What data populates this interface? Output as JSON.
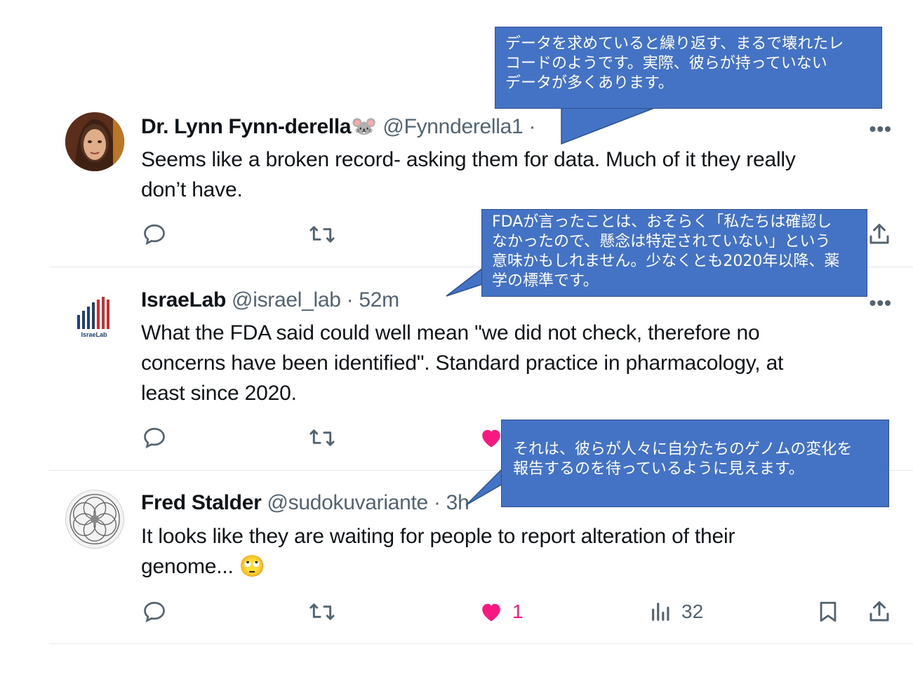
{
  "tweets": [
    {
      "name": "Dr. Lynn Fynn-derella",
      "name_emoji": "🐭",
      "handle": "@Fynnderella1 ·",
      "text_line1": "Seems like a broken record- asking them for data. Much of it they really",
      "text_line2": "don’t have.",
      "more": "•••"
    },
    {
      "name": "IsraeLab",
      "handle": "@israel_lab · 52m",
      "text_line1": "What the FDA said could well mean \"we did not check, therefore no",
      "text_line2": "concerns have been identified\". Standard practice in pharmacology, at",
      "text_line3": "least since 2020.",
      "logo_text": "IsraeLab",
      "more": "•••"
    },
    {
      "name": "Fred Stalder",
      "handle": "@sudokuvariante · 3h",
      "text_line1": "It looks like they are waiting for people to report alteration of their",
      "text_line2": "genome...",
      "emoji": "🙄",
      "likes": "1",
      "views": "32"
    }
  ],
  "callouts": [
    {
      "text": "データを求めていると繰り返す、まるで壊れたレ\nコードのようです。実際、彼らが持っていない\nデータが多くあります。"
    },
    {
      "text": "FDAが言ったことは、おそらく「私たちは確認し\nなかったので、懸念は特定されていない」という\n意味かもしれません。少なくとも2020年以降、薬\n学の標準です。"
    },
    {
      "text": "それは、彼らが人々に自分たちのゲノムの変化を\n報告するのを待っているように見えます。"
    }
  ],
  "icons": [
    "reply-icon",
    "retweet-icon",
    "like-icon",
    "views-icon",
    "bookmark-icon",
    "share-icon",
    "more-icon"
  ],
  "colors": {
    "callout_fill": "#4472c4",
    "callout_border": "#2f528f",
    "like": "#f91880",
    "muted": "#536471",
    "text": "#0f1419"
  }
}
